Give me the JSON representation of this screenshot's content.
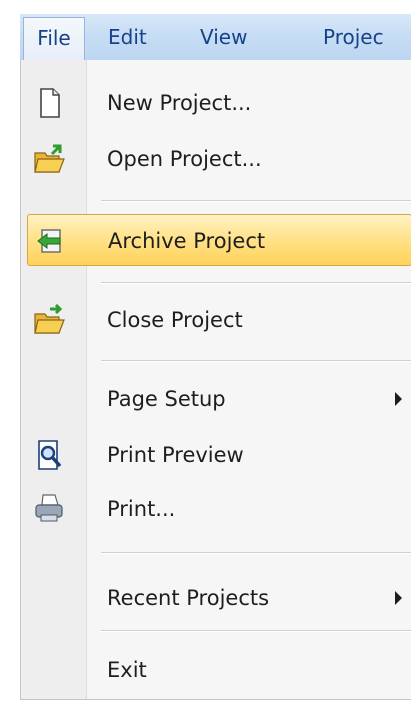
{
  "menubar": {
    "file": "File",
    "edit": "Edit",
    "view": "View",
    "project": "Projec"
  },
  "menu": {
    "new_project": "New Project...",
    "open_project": "Open Project...",
    "archive_project": "Archive Project",
    "close_project": "Close Project",
    "page_setup": "Page Setup",
    "print_preview": "Print Preview",
    "print": "Print...",
    "recent_projects": "Recent Projects",
    "exit": "Exit"
  },
  "icons": {
    "new_project": "blank-page-icon",
    "open_project": "open-folder-icon",
    "archive_project": "archive-arrow-icon",
    "close_project": "close-folder-icon",
    "print_preview": "print-preview-icon",
    "print": "printer-icon"
  },
  "colors": {
    "menubar_text": "#15428b",
    "highlight_top": "#fff3c4",
    "highlight_bottom": "#ffd25a",
    "highlight_border": "#d9a441"
  }
}
